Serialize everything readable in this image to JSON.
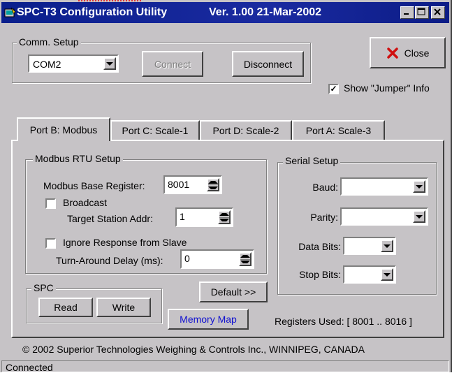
{
  "window": {
    "title": "SPC-T3 Configuration Utility",
    "version": "Ver. 1.00 21-Mar-2002"
  },
  "comm_setup": {
    "label": "Comm. Setup",
    "port": "COM2",
    "connect_label": "Connect",
    "disconnect_label": "Disconnect"
  },
  "close_label": "Close",
  "show_jumper": {
    "label": "Show \"Jumper\" Info",
    "checked": true
  },
  "tabs": [
    {
      "label": "Port B: Modbus"
    },
    {
      "label": "Port C:  Scale-1"
    },
    {
      "label": "Port D:  Scale-2"
    },
    {
      "label": "Port A: Scale-3"
    }
  ],
  "modbus": {
    "group_label": "Modbus RTU Setup",
    "base_register_label": "Modbus Base Register:",
    "base_register_value": "8001",
    "broadcast_label": "Broadcast",
    "target_station_label": "Target Station Addr:",
    "target_station_value": "1",
    "ignore_response_label": "Ignore Response from Slave",
    "turnaround_label": "Turn-Around Delay (ms):",
    "turnaround_value": "0"
  },
  "serial": {
    "group_label": "Serial Setup",
    "baud_label": "Baud:",
    "parity_label": "Parity:",
    "data_bits_label": "Data Bits:",
    "stop_bits_label": "Stop Bits:"
  },
  "spc": {
    "group_label": "SPC",
    "read_label": "Read",
    "write_label": "Write"
  },
  "default_label": "Default >>",
  "memory_map_label": "Memory Map",
  "registers_used": "Registers Used:  [ 8001 .. 8016 ]",
  "copyright": "© 2002 Superior Technologies Weighing & Controls Inc., WINNIPEG, CANADA",
  "status": "Connected",
  "colors": {
    "title_bar": "#0a1f8c",
    "face": "#c6c3c6",
    "close_x": "#d01010",
    "memory_map_text": "#1010d0"
  }
}
